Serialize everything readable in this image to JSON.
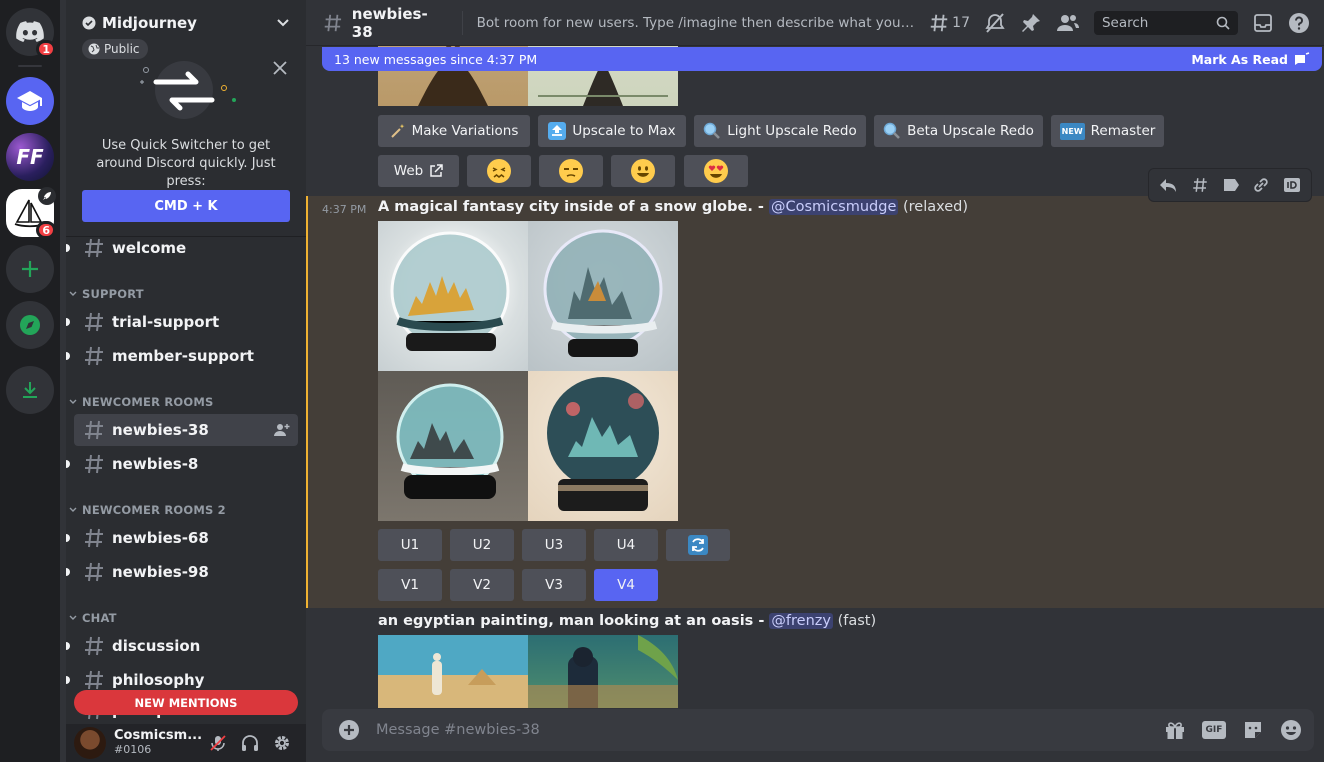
{
  "rail": {
    "servers": [
      {
        "name": "discord-home",
        "badge": "1"
      },
      {
        "name": "graduation-cap-server"
      },
      {
        "name": "ff-server",
        "label": "FF"
      },
      {
        "name": "midjourney-server",
        "badge": "6"
      },
      {
        "name": "add-server"
      },
      {
        "name": "explore-servers"
      },
      {
        "name": "download-apps"
      }
    ]
  },
  "sidebar": {
    "guild_name": "Midjourney",
    "public_label": "Public",
    "quick_switcher": {
      "text": "Use Quick Switcher to get around Discord quickly. Just press:",
      "shortcut": "CMD + K"
    },
    "channels": {
      "welcome": "welcome",
      "trial_support": "trial-support",
      "member_support": "member-support",
      "newbies_38": "newbies-38",
      "newbies_8": "newbies-8",
      "newbies_68": "newbies-68",
      "newbies_98": "newbies-98",
      "discussion": "discussion",
      "philosophy": "philosophy",
      "prompt_chat": "prompt-chat"
    },
    "categories": {
      "support": "SUPPORT",
      "newcomer_rooms": "NEWCOMER ROOMS",
      "newcomer_rooms_2": "NEWCOMER ROOMS 2",
      "chat": "CHAT"
    },
    "new_mentions": "NEW MENTIONS",
    "user": {
      "name": "Cosmicsm...",
      "tag": "#0106"
    }
  },
  "topbar": {
    "channel": "newbies-38",
    "topic": "Bot room for new users. Type /imagine then describe what you want to d...",
    "thread_count": "17",
    "search_placeholder": "Search"
  },
  "new_messages": {
    "text": "13 new messages since 4:37 PM",
    "mark_read": "Mark As Read"
  },
  "first_message_actions": {
    "make_variations": "Make Variations",
    "upscale_to_max": "Upscale to Max",
    "light_upscale_redo": "Light Upscale Redo",
    "beta_upscale_redo": "Beta Upscale Redo",
    "remaster": "Remaster",
    "new_badge": "NEW",
    "web": "Web"
  },
  "messages": [
    {
      "time": "4:37 PM",
      "prompt": "A magical fantasy city inside of a snow globe.",
      "separator": " - ",
      "mention": "@Cosmicsmudge",
      "mode": "(relaxed)",
      "upscale_buttons": [
        "U1",
        "U2",
        "U3",
        "U4"
      ],
      "variation_buttons": [
        "V1",
        "V2",
        "V3",
        "V4"
      ]
    },
    {
      "prompt": "an egyptian painting, man looking at an oasis",
      "separator": " - ",
      "mention": "@frenzy",
      "mode": "(fast)"
    }
  ],
  "composer": {
    "placeholder": "Message #newbies-38",
    "gif_label": "GIF"
  },
  "colors": {
    "blurple": "#5865f2",
    "highlight": "#443e38",
    "highlight_border": "#f0b232",
    "danger": "#da373c"
  }
}
